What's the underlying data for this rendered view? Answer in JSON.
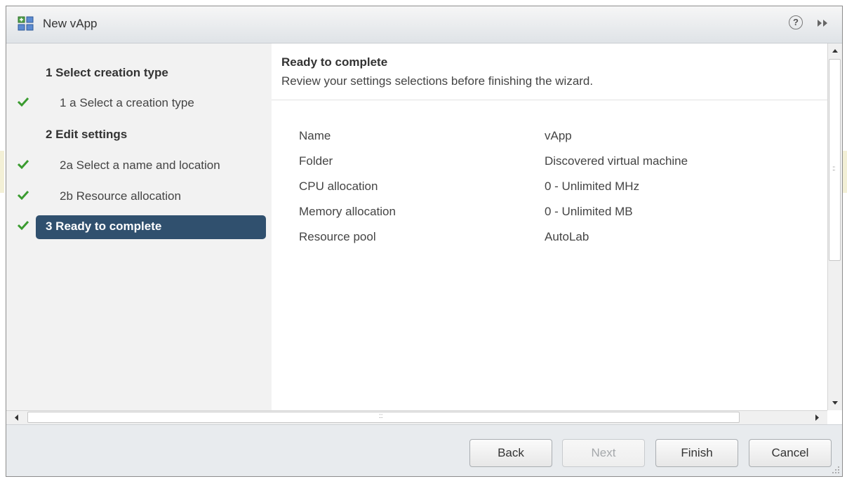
{
  "dialog": {
    "title": "New vApp",
    "help_label": "?",
    "icons": {
      "title": "vapp-icon",
      "help": "help-icon",
      "collapse": "double-chevron-right-icon"
    }
  },
  "nav": {
    "items": [
      {
        "label": "1 Select creation type",
        "kind": "heading",
        "checked": false
      },
      {
        "label": "1 a  Select a creation type",
        "kind": "sub",
        "checked": true
      },
      {
        "label": "2 Edit settings",
        "kind": "heading",
        "checked": false
      },
      {
        "label": "2a  Select a name and location",
        "kind": "sub",
        "checked": true
      },
      {
        "label": "2b  Resource allocation",
        "kind": "sub",
        "checked": true
      },
      {
        "label": "3 Ready to complete",
        "kind": "active",
        "checked": true
      }
    ]
  },
  "content": {
    "title": "Ready to complete",
    "subtitle": "Review your settings selections before finishing the wizard.",
    "rows": [
      {
        "label": "Name",
        "value": "vApp"
      },
      {
        "label": "Folder",
        "value": "Discovered virtual machine"
      },
      {
        "label": "CPU allocation",
        "value": "0 - Unlimited MHz"
      },
      {
        "label": "Memory allocation",
        "value": "0 - Unlimited MB"
      },
      {
        "label": "Resource pool",
        "value": "AutoLab"
      }
    ]
  },
  "scrollbars": {
    "grip_glyph": "::"
  },
  "footer": {
    "back_label": "Back",
    "next_label": "Next",
    "finish_label": "Finish",
    "cancel_label": "Cancel"
  },
  "colors": {
    "active_nav": "#30506e",
    "check": "#3a9b2f",
    "footer_bg": "#e8ebee"
  }
}
